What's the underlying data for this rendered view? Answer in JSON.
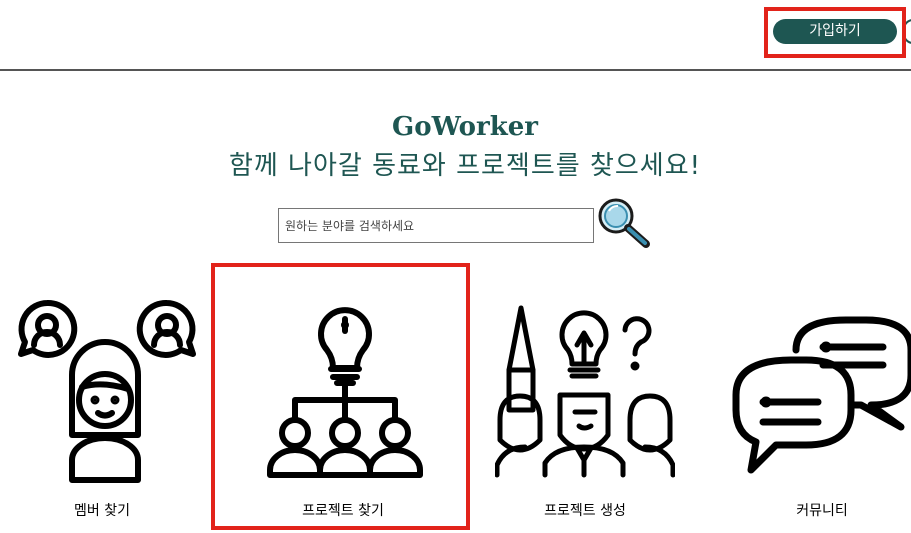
{
  "header": {
    "signup_label": "가입하기"
  },
  "hero": {
    "title": "GoWorker",
    "subtitle": "함께 나아갈 동료와 프로젝트를 찾으세요!"
  },
  "search": {
    "placeholder": "원하는 분야를 검색하세요",
    "icon": "magnifier-icon"
  },
  "menu": [
    {
      "label": "멤버 찾기",
      "icon": "member-search-icon"
    },
    {
      "label": "프로젝트 찾기",
      "icon": "project-search-icon"
    },
    {
      "label": "프로젝트 생성",
      "icon": "project-create-icon"
    },
    {
      "label": "커뮤니티",
      "icon": "community-chat-icon"
    }
  ],
  "colors": {
    "brand": "#1e5652",
    "highlight": "#e2231a"
  }
}
